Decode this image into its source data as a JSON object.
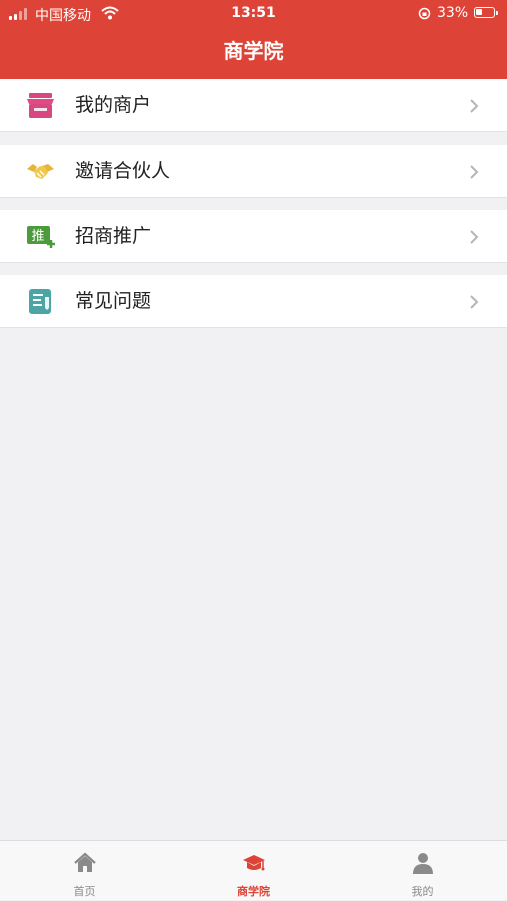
{
  "status_bar": {
    "carrier": "中国移动",
    "time": "13:51",
    "battery": "33%",
    "battery_level": 0.33
  },
  "header": {
    "title": "商学院"
  },
  "menu": [
    {
      "label": "我的商户",
      "icon": "store-icon",
      "icon_color": "#d8477f"
    },
    {
      "label": "邀请合伙人",
      "icon": "handshake-icon",
      "icon_color": "#e7b53c"
    },
    {
      "label": "招商推广",
      "icon": "promote-badge-icon",
      "icon_color": "#4c9a3c",
      "icon_text": "推"
    },
    {
      "label": "常见问题",
      "icon": "notebook-icon",
      "icon_color": "#4aa5a4"
    }
  ],
  "tabbar": {
    "items": [
      {
        "label": "首页",
        "icon": "home-icon"
      },
      {
        "label": "商学院",
        "icon": "graduation-cap-icon",
        "active": true
      },
      {
        "label": "我的",
        "icon": "user-icon"
      }
    ],
    "active_color": "#dd4437",
    "inactive_color": "#8a8a8a"
  },
  "colors": {
    "header": "#dd4437",
    "background": "#f1f1f3"
  }
}
